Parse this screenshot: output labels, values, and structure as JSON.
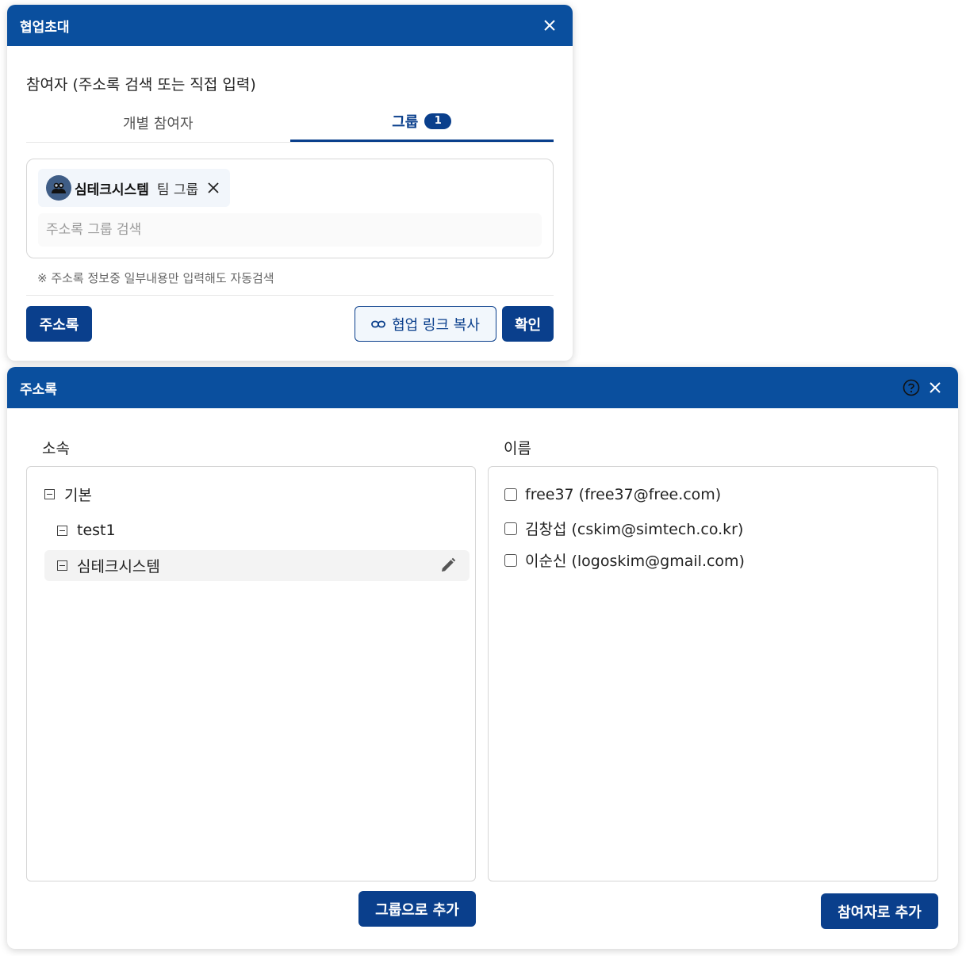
{
  "invite": {
    "title": "협업초대",
    "participants_label": "참여자 (주소록 검색 또는 직접 입력)",
    "tabs": [
      {
        "label": "개별 참여자",
        "active": false
      },
      {
        "label": "그룹",
        "active": true,
        "badge": "1"
      }
    ],
    "chip": {
      "name": "심테크시스템",
      "type": "팀 그룹",
      "icon": "group-avatar-icon"
    },
    "search_placeholder": "주소록 그룹 검색",
    "hint": "※ 주소록 정보중 일부내용만 입력해도 자동검색",
    "buttons": {
      "addressbook": "주소록",
      "copy_link": "협업 링크 복사",
      "confirm": "확인"
    }
  },
  "addressbook": {
    "title": "주소록",
    "affiliation_label": "소속",
    "name_label": "이름",
    "tree": [
      {
        "label": "기본",
        "level": 0
      },
      {
        "label": "test1",
        "level": 1
      },
      {
        "label": "심테크시스템",
        "level": 1,
        "selected": true
      }
    ],
    "contacts": [
      {
        "label": "free37 (free37@free.com)",
        "checked": false
      },
      {
        "label": "김창섭 (cskim@simtech.co.kr)",
        "checked": false
      },
      {
        "label": "이순신 (logoskim@gmail.com)",
        "checked": false
      }
    ],
    "buttons": {
      "add_group": "그룹으로 추가",
      "add_participant": "참여자로 추가"
    }
  },
  "colors": {
    "header": "#0a4f9e",
    "primary": "#0a3f8c"
  }
}
